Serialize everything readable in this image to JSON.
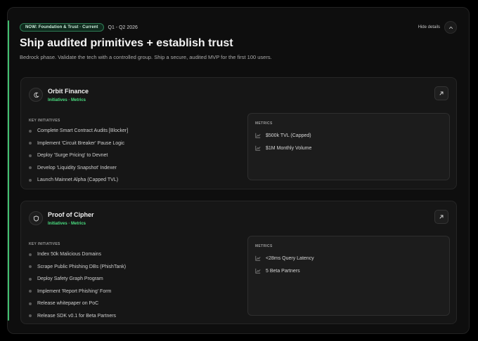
{
  "header": {
    "badge": "NOW: Foundation & Trust · Current",
    "date_range": "Q1 - Q2 2026",
    "hide_details": "Hide details"
  },
  "title": "Ship audited primitives + establish trust",
  "subtitle": "Bedrock phase. Validate the tech with a controlled group. Ship a secure, audited MVP for the first 100 users.",
  "colors": {
    "accent": "#4ade80",
    "card_bg": "#161616",
    "panel_bg": "#1c1c1c"
  },
  "cards": [
    {
      "title": "Orbit Finance",
      "tag": "Initiatives · Metrics",
      "icon": "moon-icon",
      "initiatives_label": "KEY INITIATIVES",
      "initiatives": [
        "Complete Smart Contract Audits [Blocker]",
        "Implement 'Circuit Breaker' Pause Logic",
        "Deploy 'Surge Pricing' to Devnet",
        "Develop 'Liquidity Snapshot' Indexer",
        "Launch Mainnet Alpha (Capped TVL)"
      ],
      "metrics_label": "METRICS",
      "metrics": [
        "$500k TVL (Capped)",
        "$1M Monthly Volume"
      ]
    },
    {
      "title": "Proof of Cipher",
      "tag": "Initiatives · Metrics",
      "icon": "shield-icon",
      "initiatives_label": "KEY INITIATIVES",
      "initiatives": [
        "Index 50k Malicious Domains",
        "Scrape Public Phishing DBs (PhishTank)",
        "Deploy Safety Graph Program",
        "Implement 'Report Phishing' Form",
        "Release whitepaper on PoC",
        "Release SDK v0.1 for Beta Partners"
      ],
      "metrics_label": "METRICS",
      "metrics": [
        "<28ms Query Latency",
        "5 Beta Partners"
      ]
    }
  ]
}
